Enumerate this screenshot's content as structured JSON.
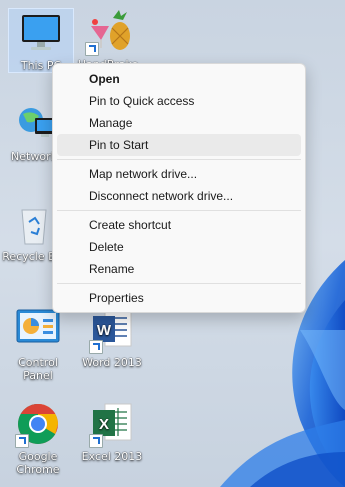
{
  "desktop": {
    "icons": [
      {
        "label": "This PC"
      },
      {
        "label": "HandBrake"
      },
      {
        "label": "Network"
      },
      {
        "label": "Recycle Bin"
      },
      {
        "label": "Control Panel"
      },
      {
        "label": "Word 2013"
      },
      {
        "label": "Google Chrome"
      },
      {
        "label": "Excel 2013"
      }
    ]
  },
  "context_menu": {
    "items": [
      {
        "label": "Open",
        "bold": true
      },
      {
        "label": "Pin to Quick access"
      },
      {
        "label": "Manage"
      },
      {
        "label": "Pin to Start",
        "highlighted": true
      },
      {
        "label": "Map network drive..."
      },
      {
        "label": "Disconnect network drive..."
      },
      {
        "label": "Create shortcut"
      },
      {
        "label": "Delete"
      },
      {
        "label": "Rename"
      },
      {
        "label": "Properties"
      }
    ]
  },
  "colors": {
    "accent_blue": "#1f6fd1",
    "menu_bg": "#f9f9f9",
    "menu_hover": "#eaeaea"
  }
}
